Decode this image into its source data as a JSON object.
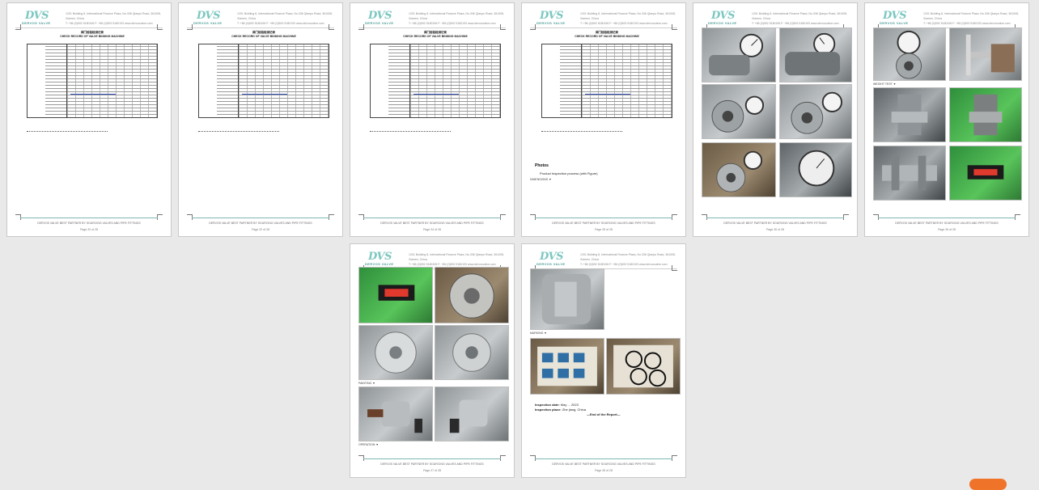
{
  "header": {
    "logo": "DVS",
    "logo_sub": "DERVOS VALVE",
    "address": "1201 Building 8, International Finance Plaza, No.336 Qianpu Road, 361008, Xiamen, China",
    "contact": "T: +86 (0)592 5180196   F: +86 (0)592 5180193   www.dervosvalve.com"
  },
  "footer_text": "DERVOS VALVE BEST PARTNER BY SOURCING VALVES AND PIPE FITTINGS",
  "form": {
    "title_cn": "阀门检验检测记录",
    "title_en": "CHECK RECORD OF VALVE BINDING MACHINE",
    "no_label": "No."
  },
  "pages": [
    {
      "id": "p1",
      "page_label": "Page 20 of 28"
    },
    {
      "id": "p2",
      "page_label": "Page 22 of 28"
    },
    {
      "id": "p3",
      "page_label": "Page 24 of 28"
    },
    {
      "id": "p4",
      "page_label": "Page 25 of 28",
      "photos_title": "Photos",
      "photos_bullet": "Product Inspection process (with Figure)",
      "photos_caption": "DIMENSIONS ▼"
    },
    {
      "id": "p5",
      "page_label": "Page 26 of 28"
    },
    {
      "id": "p6",
      "page_label": "Page 26 of 28",
      "caption": "WEIGHT TEST ▼"
    },
    {
      "id": "p7",
      "page_label": "Page 27 of 28",
      "caption1": "PAINTING ▼",
      "caption2": "OPERATION ▼"
    },
    {
      "id": "p8",
      "page_label": "Page 28 of 28",
      "caption1": "MARKING ▼",
      "insp_date_label": "Inspection date:",
      "insp_date_value": "May ... 2023",
      "insp_place_label": "Inspection place:",
      "insp_place_value": "Zhe jiang, China",
      "end_text": "—End of the Report—"
    }
  ],
  "colors": {
    "background": "#e9e9e9",
    "accent_teal": "#7cc7c0",
    "ink_blue": "#3550b8",
    "scroll_orange": "#f0732a"
  }
}
